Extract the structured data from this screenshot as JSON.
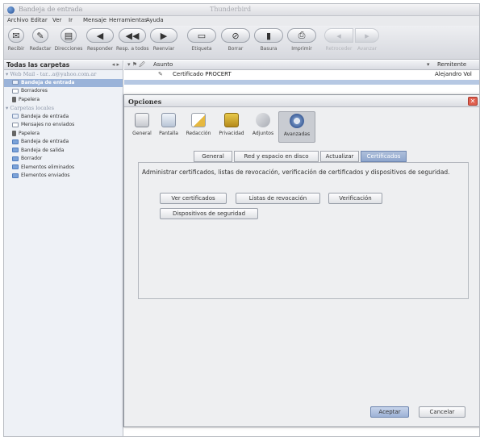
{
  "window": {
    "title_left": "Bandeja de entrada",
    "title_right": "Thunderbird"
  },
  "menu": [
    "Archivo",
    "Editar",
    "Ver",
    "Ir",
    "Mensaje",
    "Herramientas",
    "Ayuda"
  ],
  "toolbar": [
    {
      "label": "Recibir",
      "icon": "mail-icon",
      "glyph": "✉"
    },
    {
      "label": "Redactar",
      "icon": "compose-icon",
      "glyph": "✎"
    },
    {
      "label": "Direcciones",
      "icon": "address-book-icon",
      "glyph": "▤"
    },
    {
      "label": "Responder",
      "icon": "reply-icon",
      "glyph": "◀"
    },
    {
      "label": "Resp. a todos",
      "icon": "reply-all-icon",
      "glyph": "◀◀"
    },
    {
      "label": "Reenviar",
      "icon": "forward-icon",
      "glyph": "▶"
    },
    {
      "label": "Etiqueta",
      "icon": "tag-icon",
      "glyph": "▭"
    },
    {
      "label": "Borrar",
      "icon": "delete-icon",
      "glyph": "⊘"
    },
    {
      "label": "Basura",
      "icon": "junk-icon",
      "glyph": "▮"
    },
    {
      "label": "Imprimir",
      "icon": "print-icon",
      "glyph": "⎙"
    },
    {
      "label": "Retroceder",
      "icon": "back-icon",
      "glyph": "◂"
    },
    {
      "label": "Avanzar",
      "icon": "forward-nav-icon",
      "glyph": "▸"
    }
  ],
  "folders": {
    "header": "Todas las carpetas",
    "items": [
      {
        "label": "Web Mail - tar...a@yahoo.com.ar",
        "type": "account"
      },
      {
        "label": "Bandeja de entrada",
        "type": "inbox",
        "selected": true
      },
      {
        "label": "Borradores",
        "type": "draft"
      },
      {
        "label": "Papelera",
        "type": "trash"
      },
      {
        "label": "Carpetas locales",
        "type": "account"
      },
      {
        "label": "Bandeja de entrada",
        "type": "inbox"
      },
      {
        "label": "Mensajes no enviados",
        "type": "draft"
      },
      {
        "label": "Papelera",
        "type": "trash"
      },
      {
        "label": "Bandeja de entrada",
        "type": "folder"
      },
      {
        "label": "Bandeja de salida",
        "type": "folder"
      },
      {
        "label": "Borrador",
        "type": "folder"
      },
      {
        "label": "Elementos eliminados",
        "type": "folder"
      },
      {
        "label": "Elementos enviados",
        "type": "folder"
      }
    ]
  },
  "threads": {
    "col_subject": "Asunto",
    "col_sender": "Remitente",
    "rows": [
      {
        "subject": "Certificado PROCERT",
        "sender": "Alejandro Vol"
      }
    ]
  },
  "dialog": {
    "title": "Opciones",
    "panes": [
      {
        "label": "General"
      },
      {
        "label": "Pantalla"
      },
      {
        "label": "Redacción"
      },
      {
        "label": "Privacidad"
      },
      {
        "label": "Adjuntos"
      },
      {
        "label": "Avanzadas",
        "selected": true
      }
    ],
    "subtabs": [
      {
        "label": "General"
      },
      {
        "label": "Red y espacio en disco"
      },
      {
        "label": "Actualizar"
      },
      {
        "label": "Certificados",
        "selected": true
      }
    ],
    "description": "Administrar certificados, listas de revocación, verificación de certificados y dispositivos de seguridad.",
    "buttons": {
      "ver_certificados": "Ver certificados",
      "listas_revocacion": "Listas de revocación",
      "verificacion": "Verificación",
      "dispositivos": "Dispositivos de seguridad"
    },
    "accept": "Aceptar",
    "cancel": "Cancelar"
  }
}
